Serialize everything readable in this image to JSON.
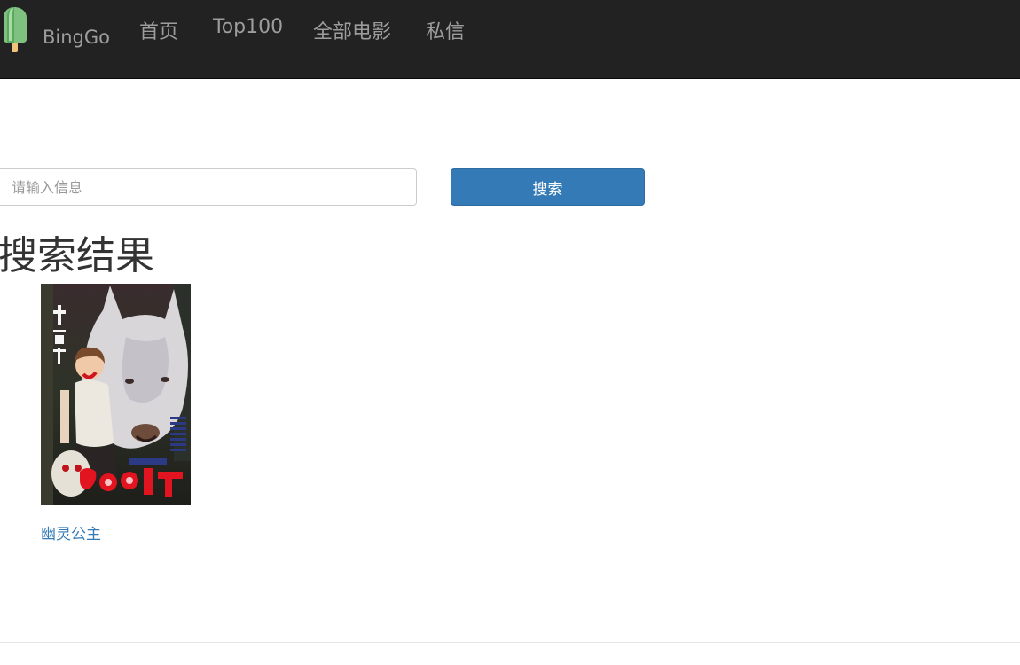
{
  "navbar": {
    "brand": "BingGo",
    "links": [
      "首页",
      "Top100",
      "全部电影",
      "私信"
    ]
  },
  "search": {
    "placeholder": "请输入信息",
    "value": "",
    "button_label": "搜索"
  },
  "results": {
    "title": "搜索结果",
    "movies": [
      {
        "title": "幽灵公主",
        "poster_icon": "movie-poster-image"
      }
    ]
  },
  "colors": {
    "navbar_bg": "#222222",
    "nav_text": "#9d9d9d",
    "primary": "#337ab7",
    "link": "#337ab7"
  }
}
